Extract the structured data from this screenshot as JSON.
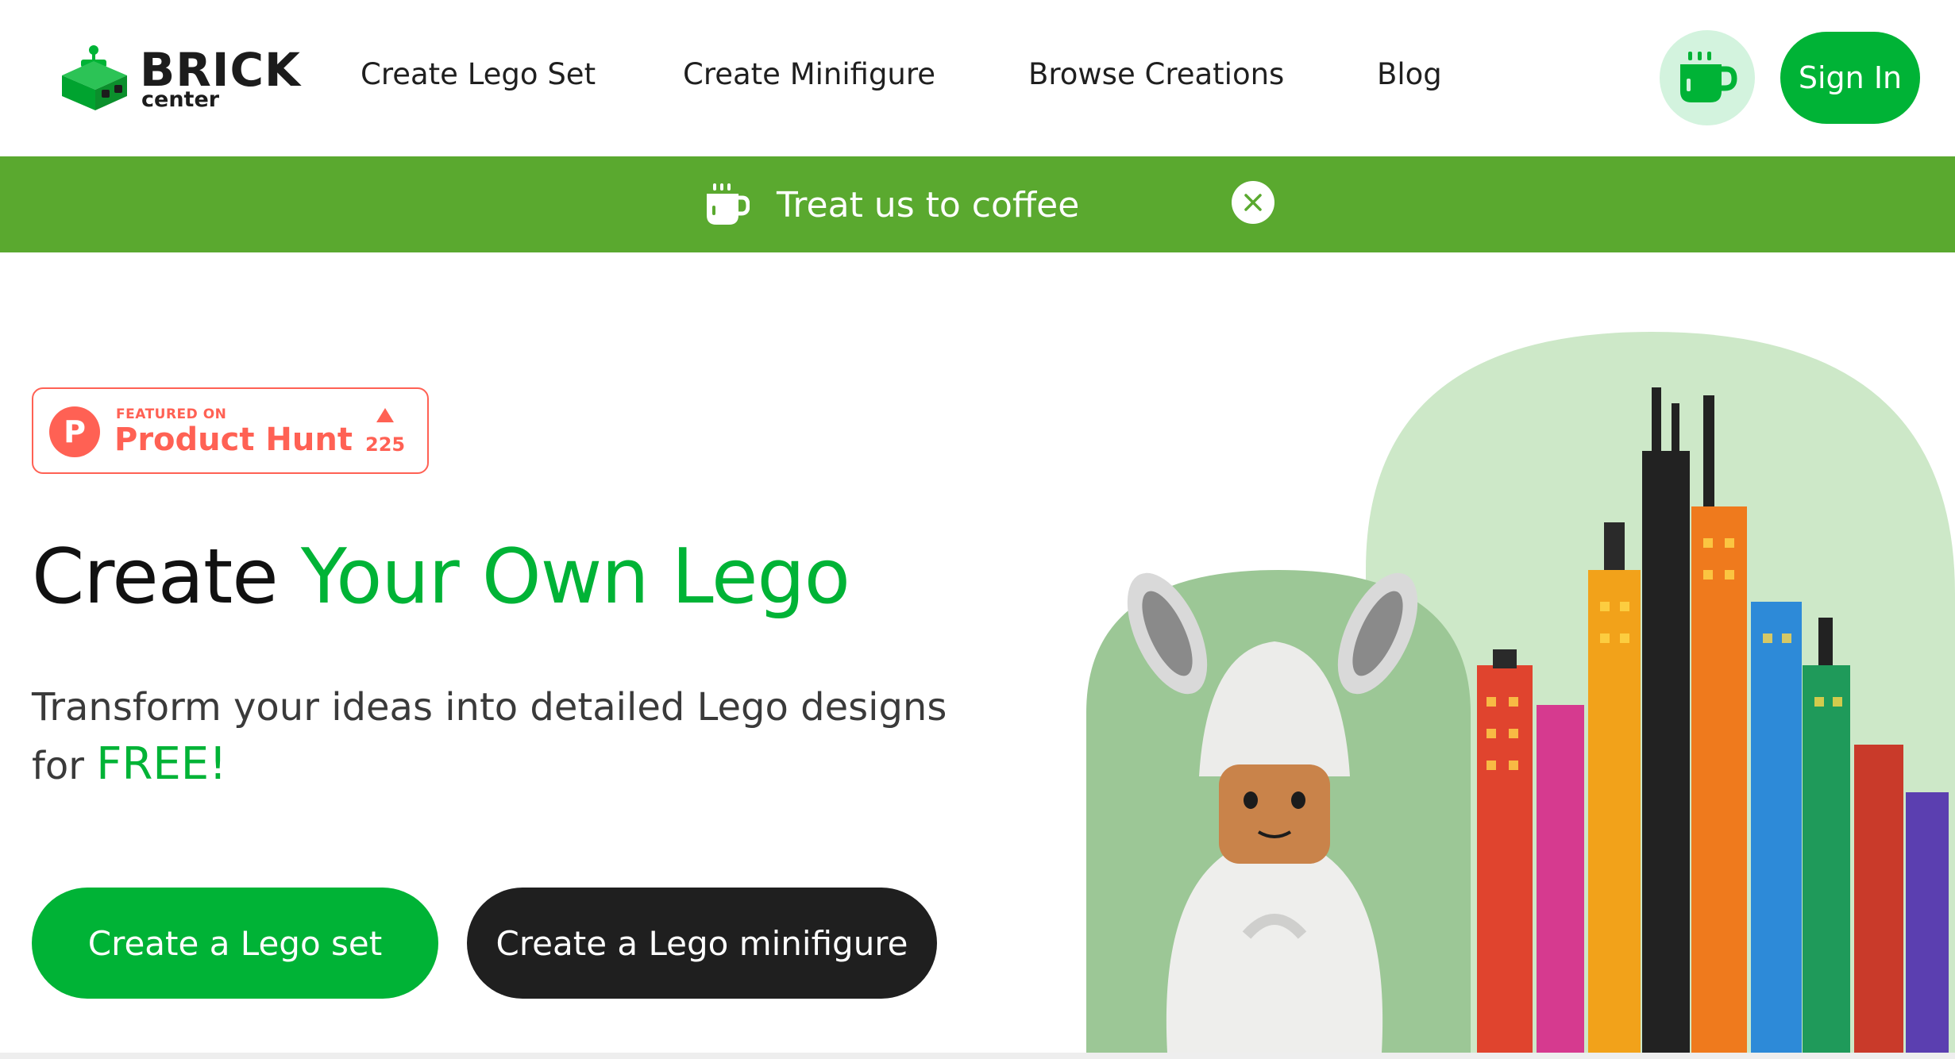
{
  "brand": {
    "name": "BRICK",
    "sub": "center",
    "logo_icon": "lego-robot-icon"
  },
  "nav": {
    "links": [
      "Create Lego Set",
      "Create Minifigure",
      "Browse Creations",
      "Blog"
    ],
    "coffee_icon": "coffee-cup-icon",
    "signin_label": "Sign In"
  },
  "banner": {
    "text": "Treat us to coffee",
    "icon": "coffee-cup-icon",
    "close_icon": "close-icon"
  },
  "product_hunt": {
    "featured": "FEATURED ON",
    "name": "Product Hunt",
    "count": "225"
  },
  "hero": {
    "title_start": "Create",
    "title_accent": "Your Own Lego",
    "subtitle_line1": "Transform your ideas into detailed Lego designs",
    "subtitle_for": "for",
    "subtitle_accent": "FREE!",
    "cta_primary": "Create a Lego set",
    "cta_secondary": "Create a Lego minifigure"
  },
  "colors": {
    "accent": "#00b336",
    "banner": "#5aa92f",
    "product_hunt": "#ff6154",
    "dark_button": "#1f1f1f"
  }
}
